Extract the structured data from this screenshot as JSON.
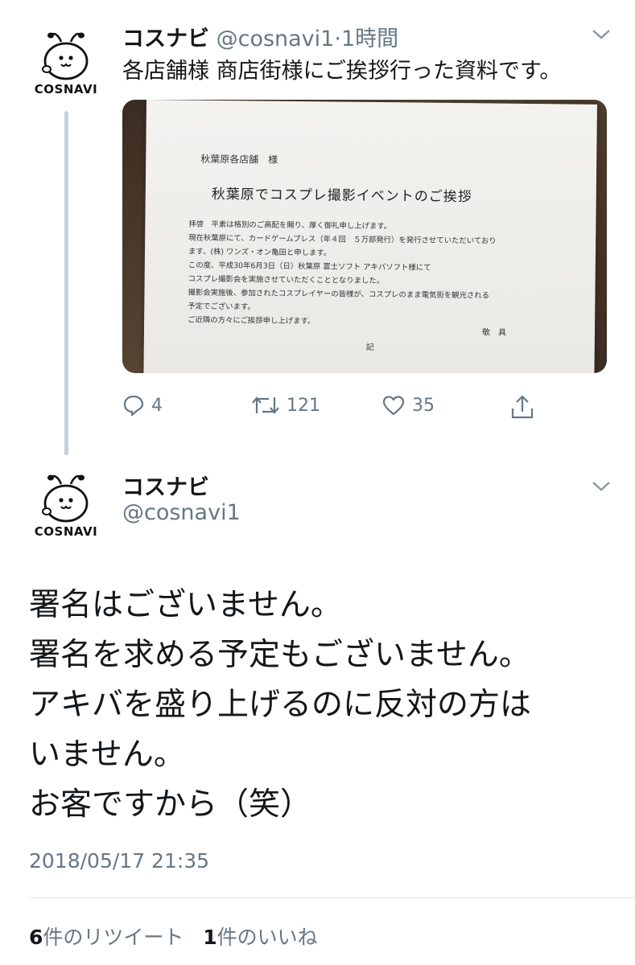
{
  "tweet1": {
    "avatar_label": "COSNAVI",
    "name": "コスナビ",
    "handle": "@cosnavi1",
    "time": "1時間",
    "separator": "·",
    "text": "各店舗様 商店街様にご挨拶行った資料です。",
    "photo": {
      "addressee": "秋葉原各店舗　様",
      "title": "秋葉原でコスプレ撮影イベントのご挨拶",
      "lines": [
        "拝啓　平素は格別のご高配を賜り、厚く御礼申し上げます。",
        "現在秋葉原にて、カードゲームプレス（年４回　５万部発行）を発行させていただいており",
        "ます、(株) ワンズ・オン亀田と申します。",
        "この度、平成30年6月3日（日）秋葉原 富士ソフト アキバソフト様にて",
        "コスプレ撮影会を実施させていただくこととなりました。",
        "撮影会実施後、参加されたコスプレイヤーの皆様が、コスプレのまま電気街を観光される",
        "予定でございます。",
        "ご近隣の方々にご挨拶申し上げます。"
      ],
      "closing": "敬　具",
      "ki": "記"
    },
    "actions": {
      "reply_count": "4",
      "retweet_count": "121",
      "like_count": "35"
    }
  },
  "tweet2": {
    "avatar_label": "COSNAVI",
    "name": "コスナビ",
    "handle": "@cosnavi1",
    "lines": [
      "署名はございません。",
      "署名を求める予定もございません。",
      "アキバを盛り上げるのに反対の方は",
      "いません。",
      "お客ですから（笑）"
    ],
    "timestamp": "2018/05/17 21:35",
    "retweet_count": "6",
    "retweet_label": "件のリツイート",
    "like_count": "1",
    "like_label": "件のいいね"
  },
  "colors": {
    "text": "#14171a",
    "secondary": "#657786",
    "thread_line": "#c4d0d9"
  }
}
